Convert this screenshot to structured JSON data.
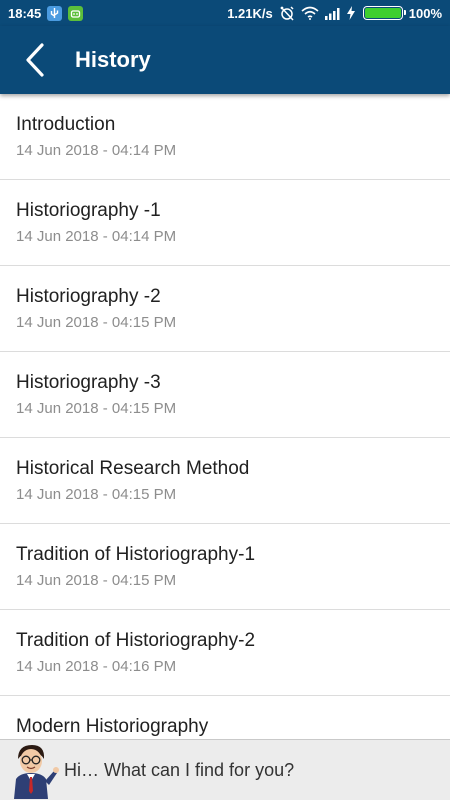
{
  "status_bar": {
    "time": "18:45",
    "network_speed": "1.21K/s",
    "battery_percent": "100%",
    "battery_level": 1.0
  },
  "header": {
    "title": "History"
  },
  "items": [
    {
      "title": "Introduction",
      "date": "14 Jun 2018 - 04:14 PM"
    },
    {
      "title": "Historiography -1",
      "date": "14 Jun 2018 - 04:14 PM"
    },
    {
      "title": "Historiography -2",
      "date": "14 Jun 2018 - 04:15 PM"
    },
    {
      "title": "Historiography -3",
      "date": "14 Jun 2018 - 04:15 PM"
    },
    {
      "title": "Historical Research Method",
      "date": "14 Jun 2018 - 04:15 PM"
    },
    {
      "title": "Tradition of Historiography-1",
      "date": "14 Jun 2018 - 04:15 PM"
    },
    {
      "title": "Tradition of Historiography-2",
      "date": "14 Jun 2018 - 04:16 PM"
    },
    {
      "title": "Modern Historiography",
      "date": ""
    }
  ],
  "assistant": {
    "prompt": "Hi… What can I find for you?"
  },
  "colors": {
    "primary": "#0b4a78",
    "battery_green": "#3ecf2f",
    "date_gray": "#8d8d8d"
  }
}
